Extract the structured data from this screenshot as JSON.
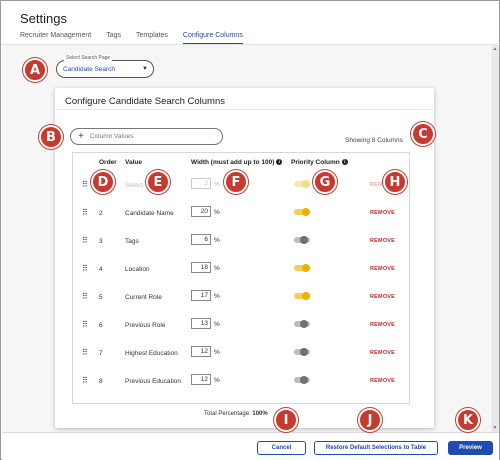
{
  "page_title": "Settings",
  "tabs": [
    {
      "label": "Recruiter Management",
      "active": false
    },
    {
      "label": "Tags",
      "active": false
    },
    {
      "label": "Templates",
      "active": false
    },
    {
      "label": "Configure Columns",
      "active": true
    }
  ],
  "search_page_select": {
    "label": "Select Search Page",
    "value": "Candidate Search"
  },
  "card": {
    "title": "Configure Candidate Search Columns",
    "add_placeholder": "Column Values",
    "showing_prefix": "Showing",
    "showing_count": "8",
    "showing_suffix": "Columns"
  },
  "table": {
    "headers": {
      "order": "Order",
      "value": "Value",
      "width": "Width (must add up to 100)",
      "priority": "Priority Column"
    },
    "rows": [
      {
        "order": "",
        "value": "Select",
        "width": "2",
        "unit": "%",
        "priority": true,
        "action": "REMOVE",
        "muted": true
      },
      {
        "order": "2",
        "value": "Candidate Name",
        "width": "20",
        "unit": "%",
        "priority": true,
        "action": "REMOVE",
        "muted": false
      },
      {
        "order": "3",
        "value": "Tags",
        "width": "6",
        "unit": "%",
        "priority": false,
        "action": "REMOVE",
        "muted": false
      },
      {
        "order": "4",
        "value": "Location",
        "width": "18",
        "unit": "%",
        "priority": true,
        "action": "REMOVE",
        "muted": false
      },
      {
        "order": "5",
        "value": "Current Role",
        "width": "17",
        "unit": "%",
        "priority": true,
        "action": "REMOVE",
        "muted": false
      },
      {
        "order": "6",
        "value": "Previous Role",
        "width": "13",
        "unit": "%",
        "priority": false,
        "action": "REMOVE",
        "muted": false
      },
      {
        "order": "7",
        "value": "Highest Education",
        "width": "12",
        "unit": "%",
        "priority": false,
        "action": "REMOVE",
        "muted": false
      },
      {
        "order": "8",
        "value": "Previous Education",
        "width": "12",
        "unit": "%",
        "priority": false,
        "action": "REMOVE",
        "muted": false
      }
    ],
    "total_label": "Total Percentage:",
    "total_value": "100%"
  },
  "footer": {
    "cancel": "Cancel",
    "restore": "Restore Default Selections to Table",
    "preview": "Preview"
  },
  "callouts": {
    "a": "A",
    "b": "B",
    "c": "C",
    "d": "D",
    "e": "E",
    "f": "F",
    "g": "G",
    "h": "H",
    "i": "I",
    "j": "J",
    "k": "K"
  },
  "icons": {
    "grip": "drag-handle-icon",
    "info": "info-icon",
    "plus": "plus-icon",
    "caret": "chevron-down-icon"
  },
  "colors": {
    "accent": "#1f4bb3",
    "remove": "#c52a2a",
    "toggle_on": "#e8b400",
    "callout": "#c63a2f"
  }
}
